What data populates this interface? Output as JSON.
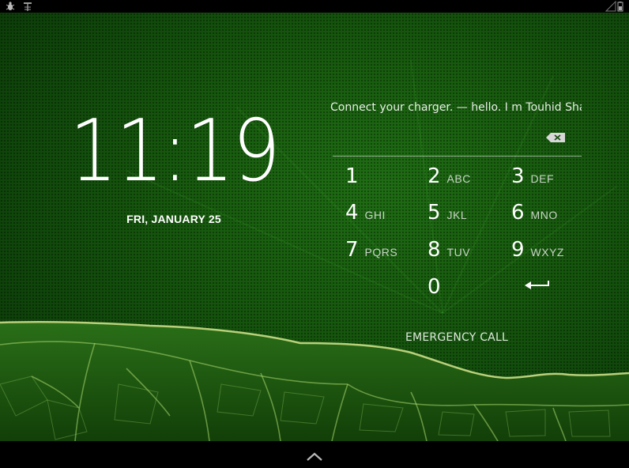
{
  "status_bar": {
    "left_icons": [
      "bug-icon",
      "usb-debug-icon"
    ],
    "right_icons": [
      "signal-icon",
      "battery-icon"
    ]
  },
  "lockscreen": {
    "time": "11:19",
    "date": "FRI, JANUARY 25",
    "owner_message": "Connect your charger. — hello. I m Touhid Shaikh"
  },
  "keypad": {
    "keys": [
      {
        "digit": "1",
        "letters": ""
      },
      {
        "digit": "2",
        "letters": "ABC"
      },
      {
        "digit": "3",
        "letters": "DEF"
      },
      {
        "digit": "4",
        "letters": "GHI"
      },
      {
        "digit": "5",
        "letters": "JKL"
      },
      {
        "digit": "6",
        "letters": "MNO"
      },
      {
        "digit": "7",
        "letters": "PQRS"
      },
      {
        "digit": "8",
        "letters": "TUV"
      },
      {
        "digit": "9",
        "letters": "WXYZ"
      },
      {
        "digit": "0",
        "letters": ""
      }
    ],
    "backspace_icon": "backspace-icon",
    "enter_icon": "enter-arrow-icon"
  },
  "emergency_call_label": "EMERGENCY CALL",
  "navigation": {
    "icon": "chevron-up-icon"
  },
  "colors": {
    "wallpaper_green": "#175a0e",
    "text": "#ffffff"
  }
}
